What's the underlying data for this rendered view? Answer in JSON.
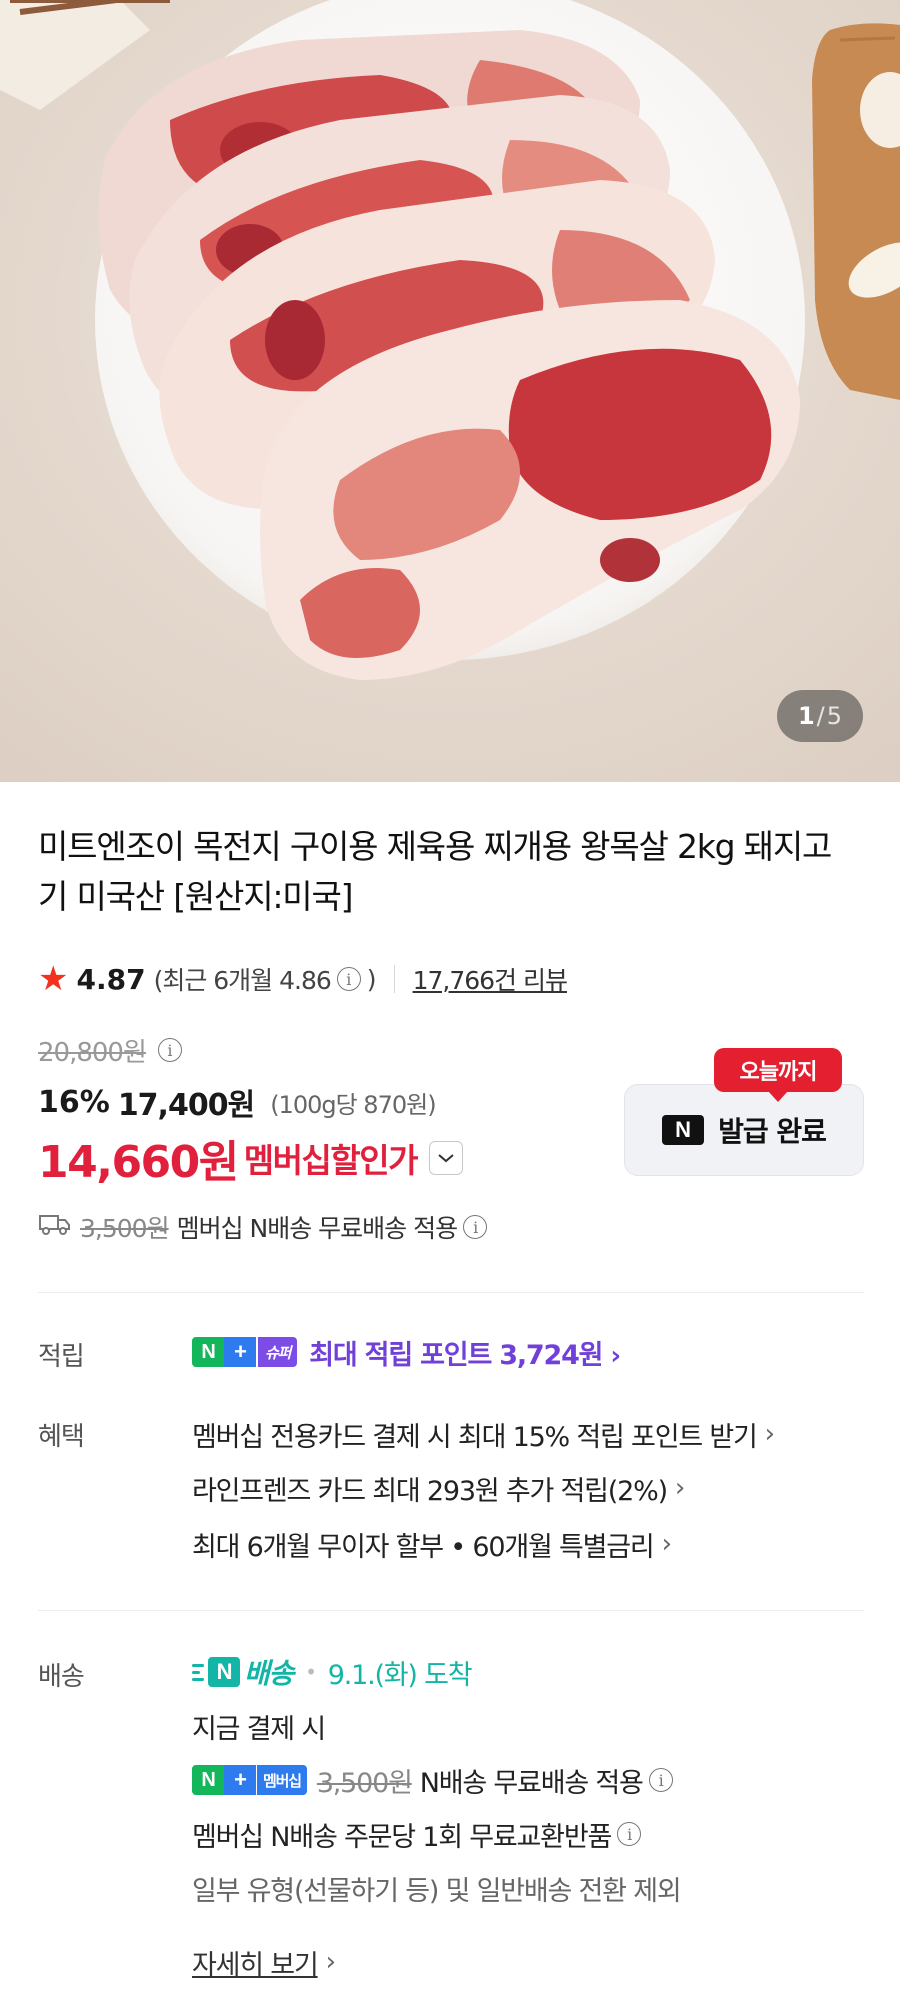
{
  "gallery": {
    "current": "1",
    "separator": "/",
    "total": "5"
  },
  "product": {
    "title": "미트엔조이 목전지 구이용 제육용 찌개용 왕목살 2kg 돼지고기 미국산 [원산지:미국]"
  },
  "rating": {
    "star_icon": "star-icon",
    "score": "4.87",
    "recent": "(최근 6개월 4.86",
    "recent_close": ")",
    "review_link": "17,766건 리뷰"
  },
  "price": {
    "original": "20,800원",
    "discount_rate": "16%",
    "sale_price": "17,400원",
    "unit_price": "(100g당 870원)",
    "member_price": "14,660원",
    "member_label": "멤버십할인가"
  },
  "coupon": {
    "tag": "오늘까지",
    "logo": "N",
    "button": "발급 완료"
  },
  "shipping_fee": {
    "fee": "3,500원",
    "text": "멤버십 N배송 무료배송 적용"
  },
  "points": {
    "label": "적립",
    "badge_n": "N",
    "badge_plus": "+",
    "badge_super": "슈퍼",
    "text": "최대 적립 포인트 3,724원"
  },
  "benefits": {
    "label": "혜택",
    "items": [
      "멤버십 전용카드 결제 시 최대 15% 적립 포인트 받기",
      "라인프렌즈 카드 최대 293원 추가 적립(2%)",
      "최대 6개월 무이자 할부 • 60개월 특별금리"
    ]
  },
  "delivery": {
    "label": "배송",
    "brand_n": "N",
    "brand_text": "배송",
    "separator": "•",
    "arrival": "9.1.(화) 도착",
    "pay_now": "지금 결제 시",
    "badge_n": "N",
    "badge_plus": "+",
    "badge_member": "멤버십",
    "fee_strike": "3,500원",
    "free_text": "N배송 무료배송 적용",
    "exchange": "멤버십 N배송 주문당 1회 무료교환반품",
    "exclude": "일부 유형(선물하기 등) 및 일반배송 전환 제외",
    "detail_link": "자세히 보기"
  },
  "colors": {
    "member_red": "#e0203d",
    "coupon_red": "#e41f2f",
    "point_purple": "#7040d9",
    "delivery_teal": "#12b5a6",
    "badge_green": "#13b65a",
    "badge_blue": "#2d7bee"
  }
}
